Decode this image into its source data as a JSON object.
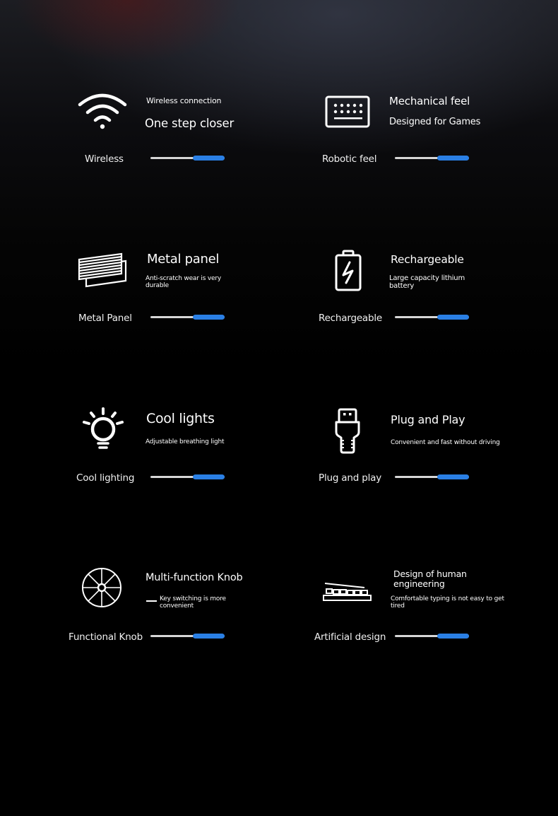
{
  "accent_color": "#2a7fe4",
  "track_color": "#d6d6d6",
  "features": [
    {
      "icon": "wifi-icon",
      "title_small": "Wireless connection",
      "title": "One step closer",
      "caption": "Wireless",
      "slider_fill_start": 0.57,
      "slider_value": 1.0
    },
    {
      "icon": "keyboard-icon",
      "title": "Mechanical feel",
      "subtitle": "Designed for Games",
      "caption": "Robotic feel",
      "slider_fill_start": 0.57,
      "slider_value": 1.0
    },
    {
      "icon": "metal-panel-icon",
      "title": "Metal panel",
      "subtitle": "Anti-scratch wear is very durable",
      "caption": "Metal Panel",
      "slider_fill_start": 0.57,
      "slider_value": 1.0
    },
    {
      "icon": "battery-icon",
      "title": "Rechargeable",
      "subtitle": "Large capacity lithium battery",
      "caption": "Rechargeable",
      "slider_fill_start": 0.57,
      "slider_value": 1.0
    },
    {
      "icon": "light-bulb-icon",
      "title": "Cool lights",
      "subtitle": "Adjustable breathing light",
      "caption": "Cool lighting",
      "slider_fill_start": 0.57,
      "slider_value": 1.0
    },
    {
      "icon": "usb-plug-icon",
      "title": "Plug and Play",
      "subtitle": "Convenient and fast without driving",
      "caption": "Plug and play",
      "slider_fill_start": 0.57,
      "slider_value": 1.0
    },
    {
      "icon": "knob-icon",
      "title": "Multi-function Knob",
      "subtitle": "Key switching is more convenient",
      "caption": "Functional Knob",
      "slider_fill_start": 0.57,
      "slider_value": 1.0
    },
    {
      "icon": "ergonomic-keyboard-icon",
      "title": "Design of human engineering",
      "subtitle": "Comfortable typing is not easy to get tired",
      "caption": "Artificial design",
      "slider_fill_start": 0.57,
      "slider_value": 1.0
    }
  ]
}
